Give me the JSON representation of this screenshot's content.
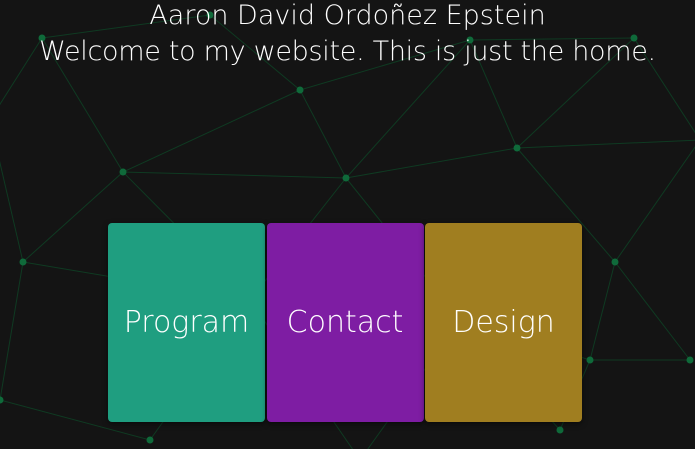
{
  "header": {
    "title": "Aaron David Ordoñez Epstein",
    "subtitle": "Welcome to my website. This is just the home."
  },
  "cards": [
    {
      "label": "Program",
      "color": "#1f9e80"
    },
    {
      "label": "Contact",
      "color": "#7e1da3"
    },
    {
      "label": "Design",
      "color": "#a07e20"
    }
  ],
  "background": {
    "base_color": "#141414",
    "line_color": "#0f3a22",
    "node_color": "#0f6a3a"
  }
}
